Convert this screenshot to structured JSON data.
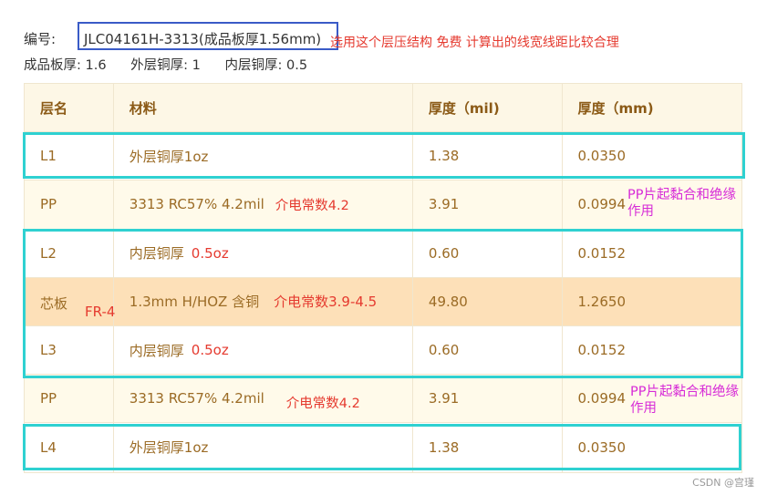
{
  "header": {
    "code_label": "编号:",
    "code_value": "JLC04161H-3313(成品板厚1.56mm)",
    "note": "选用这个层压结构 免费 计算出的线宽线距比较合理",
    "meta": {
      "board_thickness": "成品板厚:  1.6",
      "outer_copper": "外层铜厚:  1",
      "inner_copper": "内层铜厚:  0.5"
    }
  },
  "table": {
    "headers": [
      "层名",
      "材料",
      "厚度（mil)",
      "厚度（mm)"
    ],
    "rows": [
      {
        "layer": "L1",
        "material": "外层铜厚1oz",
        "mil": "1.38",
        "mm": "0.0350"
      },
      {
        "layer": "PP",
        "material": "3313 RC57% 4.2mil",
        "mil": "3.91",
        "mm": "0.0994"
      },
      {
        "layer": "L2",
        "material": "内层铜厚",
        "mil": "0.60",
        "mm": "0.0152"
      },
      {
        "layer": "芯板",
        "material": "1.3mm H/HOZ 含铜",
        "mil": "49.80",
        "mm": "1.2650"
      },
      {
        "layer": "L3",
        "material": "内层铜厚",
        "mil": "0.60",
        "mm": "0.0152"
      },
      {
        "layer": "PP",
        "material": "3313 RC57% 4.2mil",
        "mil": "3.91",
        "mm": "0.0994"
      },
      {
        "layer": "L4",
        "material": "外层铜厚1oz",
        "mil": "1.38",
        "mm": "0.0350"
      }
    ]
  },
  "annotations": {
    "dk_pp": "介电常数4.2",
    "dk_core": "介电常数3.9-4.5",
    "core_material": "FR-4",
    "inner_oz": "0.5oz",
    "pp_note_line1": "PP片起黏合和绝缘",
    "pp_note_line2": "作用"
  },
  "watermark": "CSDN @宫瑾",
  "colors": {
    "highlight_frame": "#2fd1d1",
    "code_frame": "#3a5bc7",
    "annotation_red": "#e53a2f",
    "annotation_magenta": "#d72bd7",
    "core_row": "#fde0b8"
  }
}
